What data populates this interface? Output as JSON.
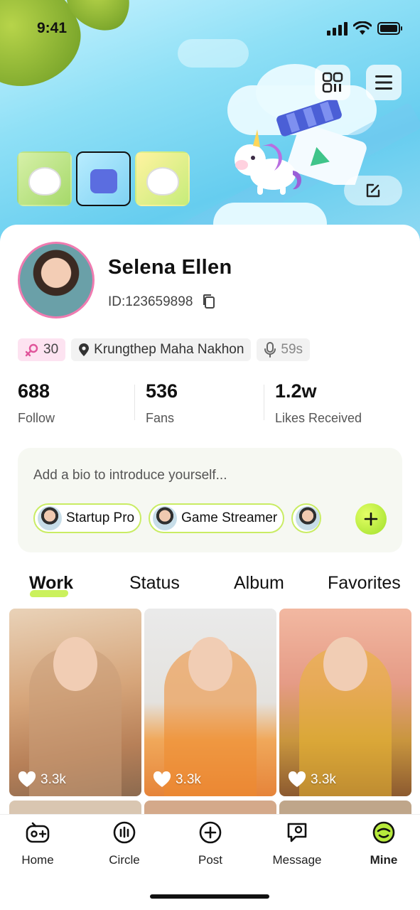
{
  "status_bar": {
    "time": "9:41"
  },
  "profile": {
    "name": "Selena Ellen",
    "id": "ID:123659898",
    "gender_age": "30",
    "location": "Krungthep Maha Nakhon",
    "voice_duration": "59s"
  },
  "stats": [
    {
      "value": "688",
      "label": "Follow"
    },
    {
      "value": "536",
      "label": "Fans"
    },
    {
      "value": "1.2w",
      "label": "Likes Received"
    }
  ],
  "bio": {
    "placeholder": "Add a bio to introduce yourself...",
    "chips": [
      "Startup Pro",
      "Game Streamer"
    ]
  },
  "tabs": [
    {
      "label": "Work",
      "active": true
    },
    {
      "label": "Status",
      "active": false
    },
    {
      "label": "Album",
      "active": false
    },
    {
      "label": "Favorites",
      "active": false
    }
  ],
  "works": [
    {
      "likes": "3.3k"
    },
    {
      "likes": "3.3k"
    },
    {
      "likes": "3.3k"
    }
  ],
  "bottom_nav": [
    {
      "label": "Home",
      "icon": "gamepad-icon"
    },
    {
      "label": "Circle",
      "icon": "circle-icon"
    },
    {
      "label": "Post",
      "icon": "plus-circle-icon"
    },
    {
      "label": "Message",
      "icon": "message-icon"
    },
    {
      "label": "Mine",
      "icon": "mine-icon",
      "active": true
    }
  ],
  "colors": {
    "accent_green": "#c5ef4a",
    "gender_pink": "#e0559b",
    "avatar_border": "#ef7bb0"
  }
}
